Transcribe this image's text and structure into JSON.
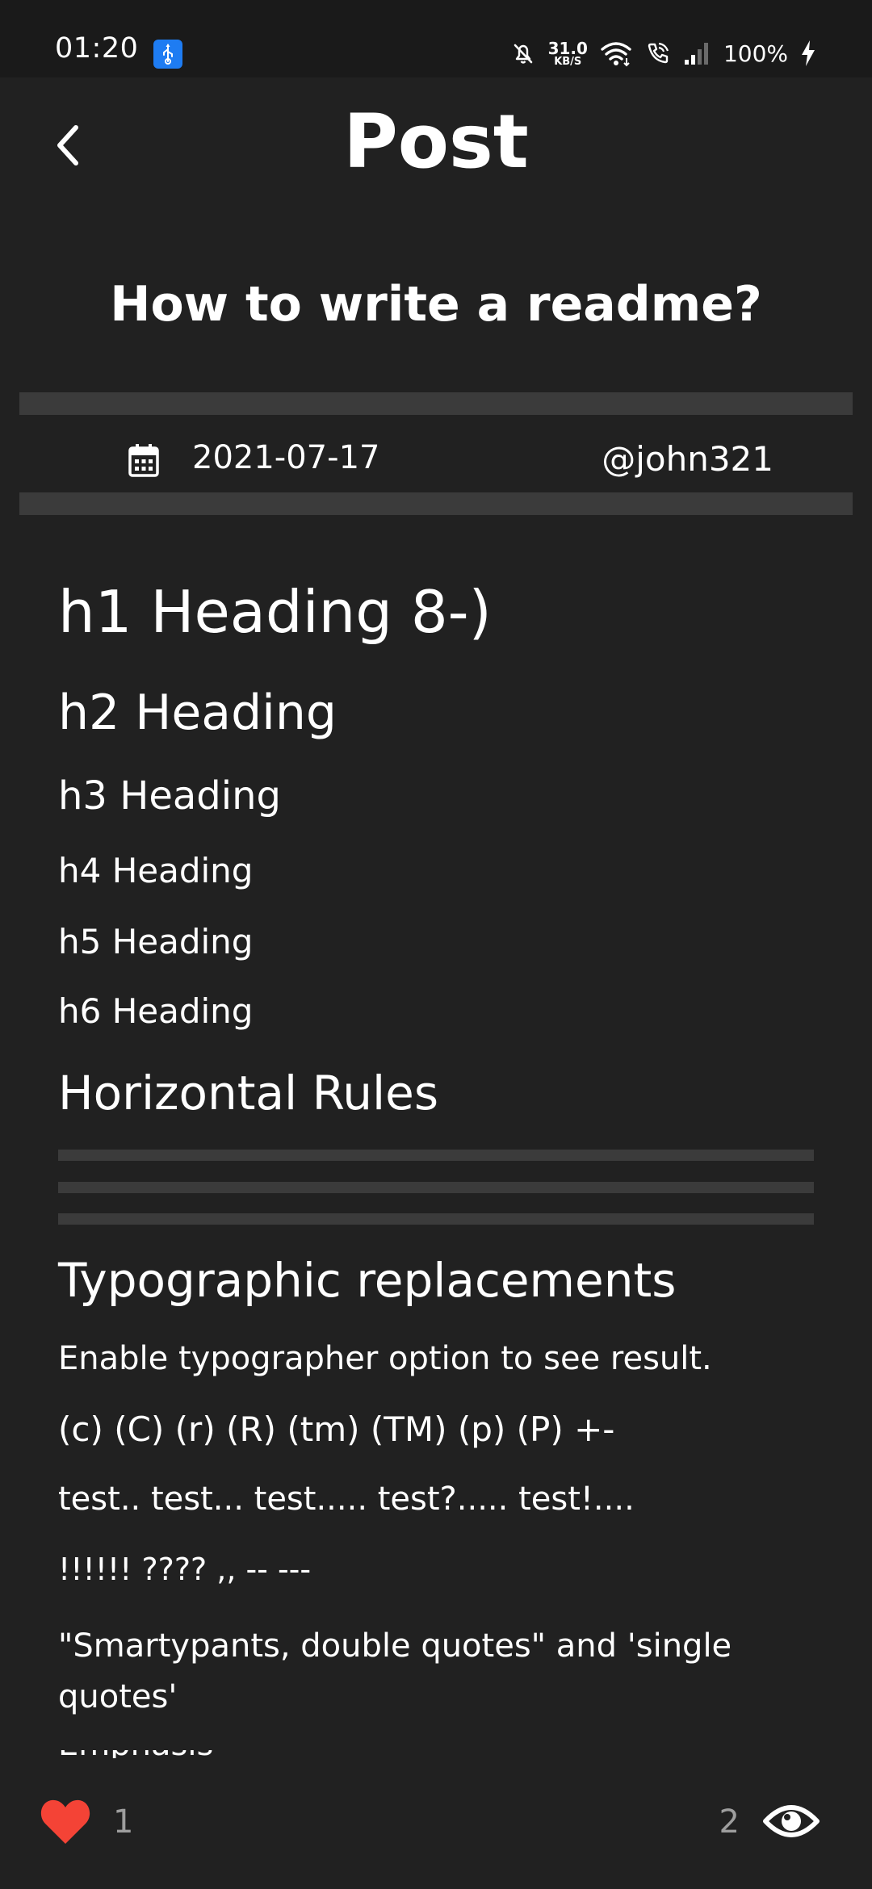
{
  "status_bar": {
    "time": "01:20",
    "net_speed_value": "31.0",
    "net_speed_unit": "KB/S",
    "battery": "100%"
  },
  "header": {
    "title": "Post",
    "back_icon": "chevron-left-icon"
  },
  "post": {
    "title": "How to write a readme?",
    "date": "2021-07-17",
    "author": "@john321"
  },
  "content": {
    "h1": "h1 Heading 8-)",
    "h2": "h2 Heading",
    "h3": "h3 Heading",
    "h4": "h4 Heading",
    "h5": "h5 Heading",
    "h6": "h6 Heading",
    "horizontal_rules_heading": "Horizontal Rules",
    "typographic_heading": "Typographic replacements",
    "paragraphs": [
      "Enable typographer option to see result.",
      "(c) (C) (r) (R) (tm) (TM) (p) (P) +-",
      "test.. test... test..... test?..... test!....",
      "!!!!!! ???? ,,  -- ---",
      "\"Smartypants, double quotes\" and 'single quotes'"
    ]
  },
  "footer": {
    "likes": "1",
    "views": "2"
  },
  "colors": {
    "background": "#212121",
    "status_bar": "#1a1a1a",
    "rule": "#3b3b3b",
    "like": "#f44336",
    "counter": "#9e9e9e",
    "usb_badge": "#1e7cf2"
  }
}
